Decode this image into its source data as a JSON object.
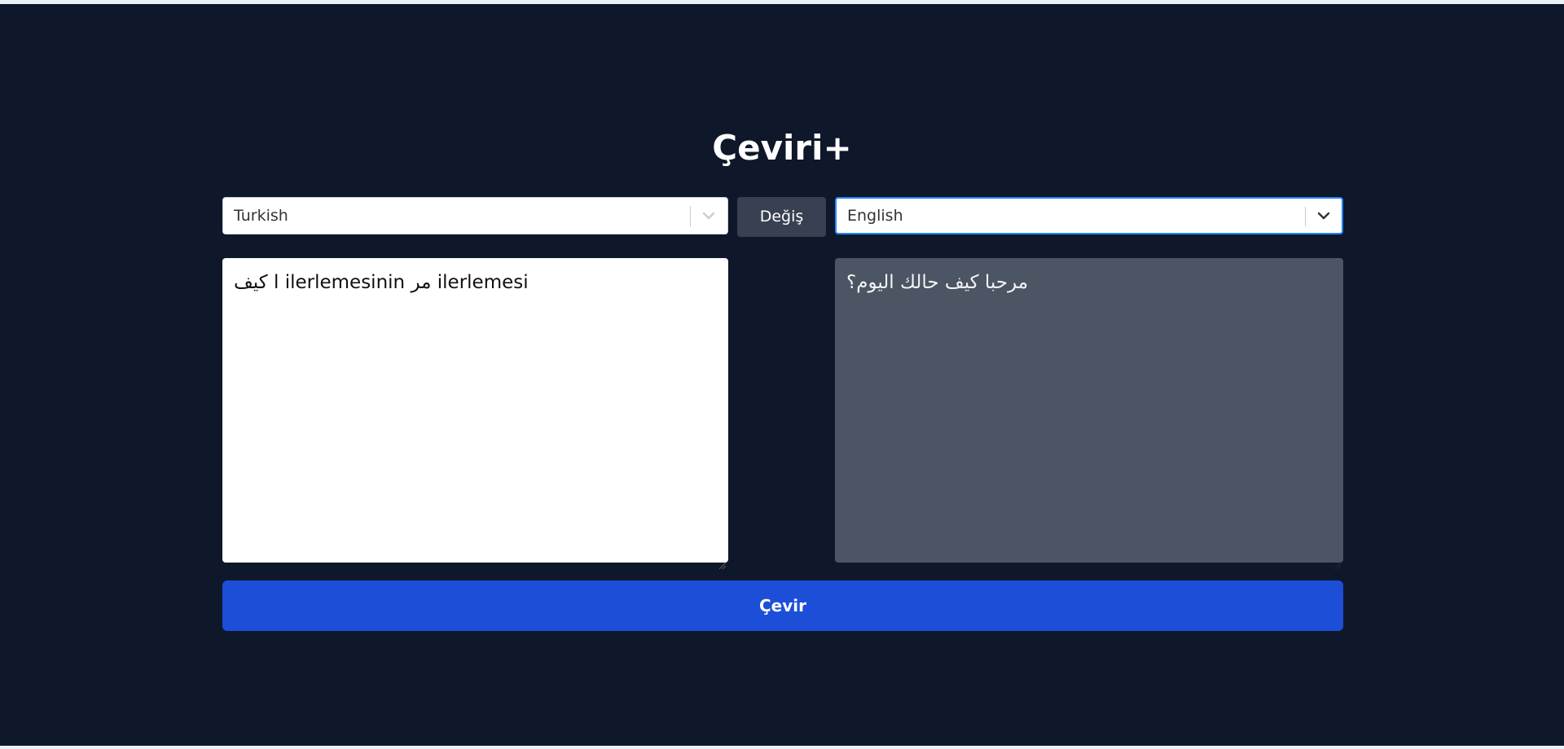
{
  "app": {
    "title": "Çeviri+"
  },
  "source_language": {
    "selected": "Turkish"
  },
  "target_language": {
    "selected": "English"
  },
  "swap_button": {
    "label": "Değiş"
  },
  "source_text": {
    "value": "كيف l ilerlemesinin مر ilerlemesi"
  },
  "target_text": {
    "value": "مرحبا كيف حالك اليوم؟"
  },
  "translate_button": {
    "label": "Çevir"
  },
  "colors": {
    "background": "#0f172a",
    "primary_button": "#1d4ed8",
    "swap_button": "#374151",
    "output_area": "#4b5563",
    "focus_border": "#2684ff"
  }
}
